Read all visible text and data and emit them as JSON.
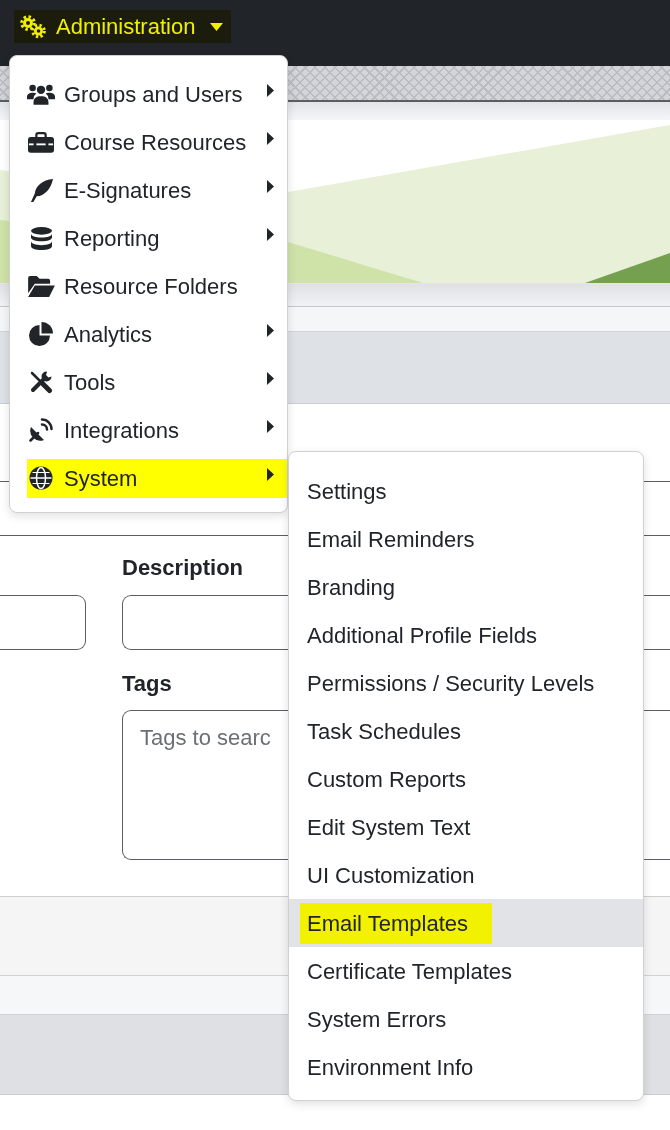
{
  "navbar": {
    "menu_toggle": {
      "label": "Administration",
      "expanded": true,
      "highlighted": true
    }
  },
  "admin_menu": {
    "items": [
      {
        "label": "Groups and Users",
        "has_submenu": true,
        "highlighted": false
      },
      {
        "label": "Course Resources",
        "has_submenu": true,
        "highlighted": false
      },
      {
        "label": "E-Signatures",
        "has_submenu": true,
        "highlighted": false
      },
      {
        "label": "Reporting",
        "has_submenu": true,
        "highlighted": false
      },
      {
        "label": "Resource Folders",
        "has_submenu": false,
        "highlighted": false
      },
      {
        "label": "Analytics",
        "has_submenu": true,
        "highlighted": false
      },
      {
        "label": "Tools",
        "has_submenu": true,
        "highlighted": false
      },
      {
        "label": "Integrations",
        "has_submenu": true,
        "highlighted": false
      },
      {
        "label": "System",
        "has_submenu": true,
        "highlighted": true
      }
    ]
  },
  "system_menu": {
    "items": [
      {
        "label": "Settings",
        "selected": false,
        "highlighted": false
      },
      {
        "label": "Email Reminders",
        "selected": false,
        "highlighted": false
      },
      {
        "label": "Branding",
        "selected": false,
        "highlighted": false
      },
      {
        "label": "Additional Profile Fields",
        "selected": false,
        "highlighted": false
      },
      {
        "label": "Permissions / Security Levels",
        "selected": false,
        "highlighted": false
      },
      {
        "label": "Task Schedules",
        "selected": false,
        "highlighted": false
      },
      {
        "label": "Custom Reports",
        "selected": false,
        "highlighted": false
      },
      {
        "label": "Edit System Text",
        "selected": false,
        "highlighted": false
      },
      {
        "label": "UI Customization",
        "selected": false,
        "highlighted": false
      },
      {
        "label": "Email Templates",
        "selected": true,
        "highlighted": true
      },
      {
        "label": "Certificate Templates",
        "selected": false,
        "highlighted": false
      },
      {
        "label": "System Errors",
        "selected": false,
        "highlighted": false
      },
      {
        "label": "Environment Info",
        "selected": false,
        "highlighted": false
      }
    ]
  },
  "form": {
    "description": {
      "label": "Description"
    },
    "tags": {
      "label": "Tags",
      "placeholder": "Tags to searc"
    }
  }
}
